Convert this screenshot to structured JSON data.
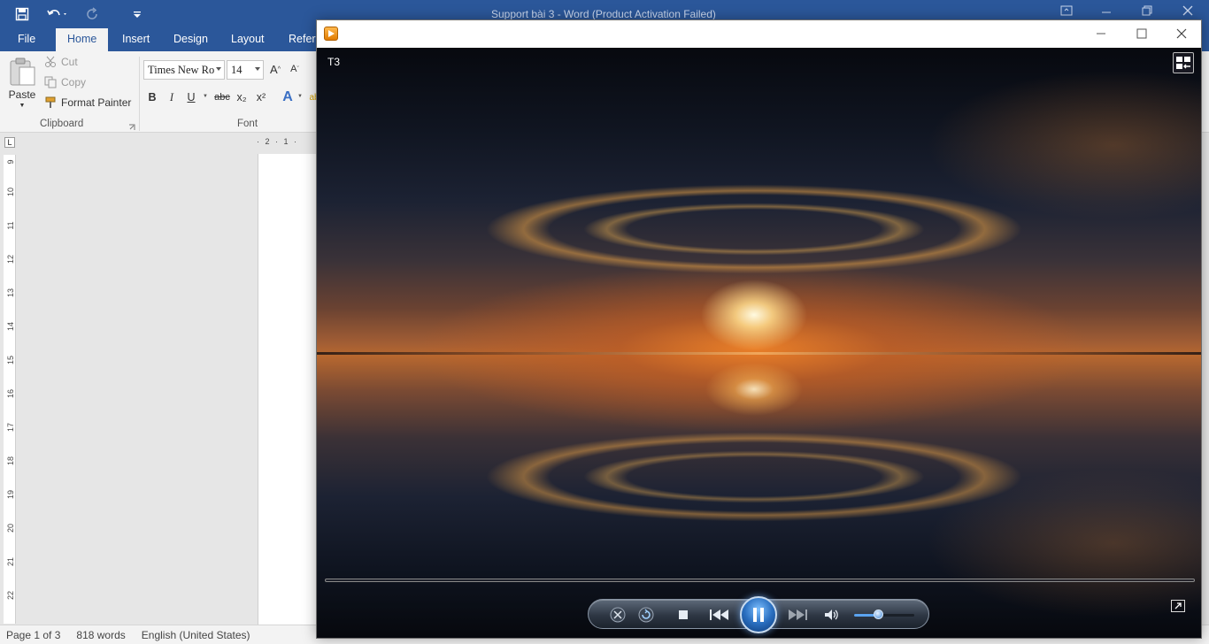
{
  "word": {
    "title": "Support bài 3 - Word (Product Activation Failed)",
    "tabs": [
      "File",
      "Home",
      "Insert",
      "Design",
      "Layout",
      "Refere"
    ],
    "active_tab": "Home",
    "clipboard": {
      "paste": "Paste",
      "cut": "Cut",
      "copy": "Copy",
      "format_painter": "Format Painter",
      "group_label": "Clipboard"
    },
    "font": {
      "family": "Times New Ro",
      "size": "14",
      "bold": "B",
      "italic": "I",
      "underline": "U",
      "strike": "abc",
      "sub": "x₂",
      "sup": "x²",
      "group_label": "Font"
    },
    "ruler": {
      "corner": "L",
      "h_marks": "· 2 · 1 ·",
      "v_marks": [
        "9",
        "10",
        "11",
        "12",
        "13",
        "14",
        "15",
        "16",
        "17",
        "18",
        "19",
        "20",
        "21",
        "22"
      ]
    },
    "status": {
      "page": "Page 1 of 3",
      "words": "818 words",
      "language": "English (United States)"
    }
  },
  "player": {
    "video_label": "T3",
    "progress": 0,
    "volume": 0.4,
    "colors": {
      "accent": "#5ba3ef",
      "word_blue": "#2b579a"
    }
  }
}
